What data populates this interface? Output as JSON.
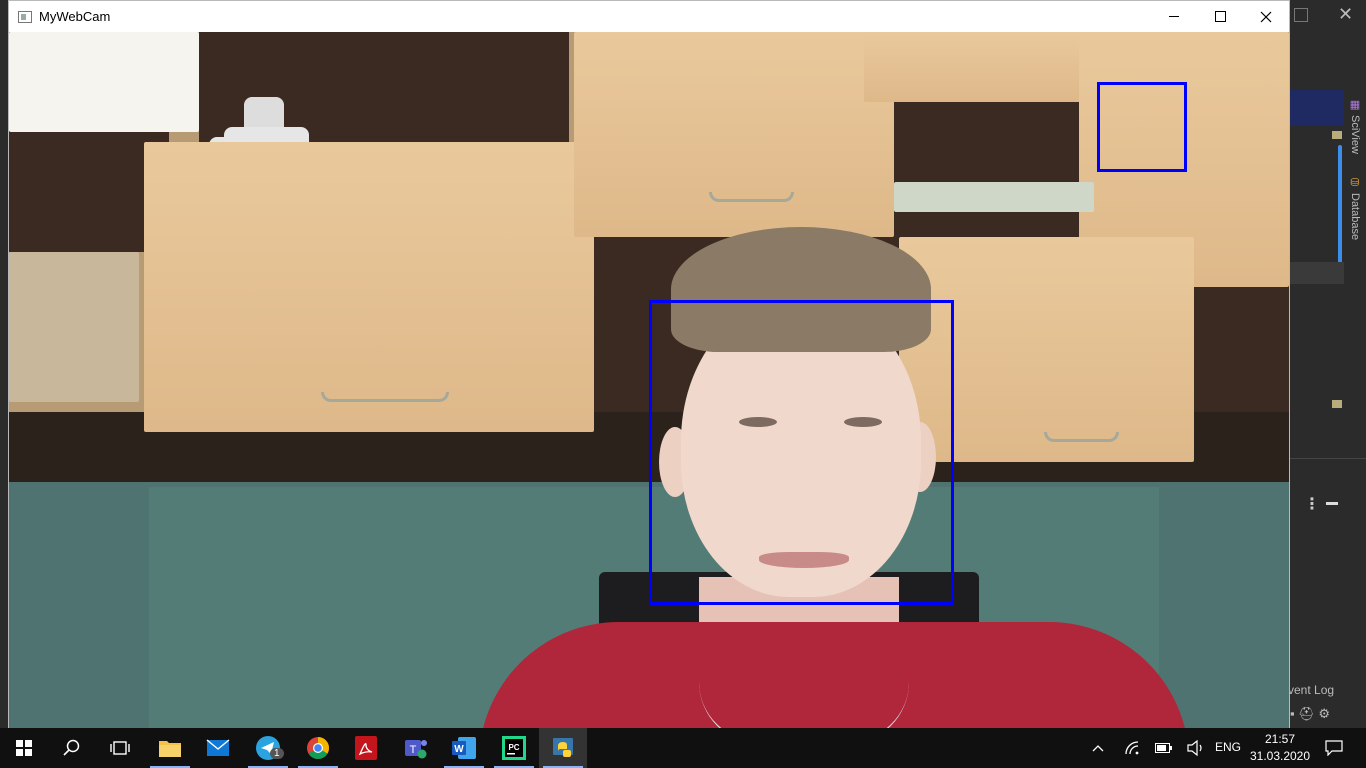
{
  "window": {
    "title": "MyWebCam",
    "controls": {
      "minimize": "minimize",
      "maximize": "maximize",
      "close": "close"
    }
  },
  "camera": {
    "detections": [
      {
        "label": "face"
      },
      {
        "label": "object"
      }
    ],
    "detection_color": "#0000ff"
  },
  "ide_background": {
    "side_tabs": [
      "SciView",
      "Database"
    ],
    "status_label": "vent Log"
  },
  "taskbar": {
    "apps": [
      {
        "name": "start",
        "icon": "windows-logo-icon"
      },
      {
        "name": "search",
        "icon": "search-icon"
      },
      {
        "name": "task-view",
        "icon": "task-view-icon"
      },
      {
        "name": "file-explorer",
        "icon": "folder-icon"
      },
      {
        "name": "mail",
        "icon": "mail-icon"
      },
      {
        "name": "telegram",
        "icon": "telegram-icon",
        "badge": "1"
      },
      {
        "name": "chrome",
        "icon": "chrome-icon"
      },
      {
        "name": "acrobat",
        "icon": "acrobat-icon"
      },
      {
        "name": "teams",
        "icon": "teams-icon"
      },
      {
        "name": "word",
        "icon": "word-icon"
      },
      {
        "name": "pycharm",
        "icon": "pycharm-icon"
      },
      {
        "name": "python",
        "icon": "python-icon",
        "active": true
      }
    ],
    "tray": {
      "language": "ENG",
      "time": "21:57",
      "date": "31.03.2020"
    }
  }
}
